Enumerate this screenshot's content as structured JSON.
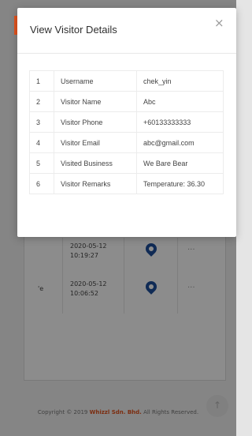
{
  "modal": {
    "title": "View Visitor Details",
    "close": "×",
    "rows": [
      {
        "num": "1",
        "label": "Username",
        "value": "chek_yin"
      },
      {
        "num": "2",
        "label": "Visitor Name",
        "value": "Abc"
      },
      {
        "num": "3",
        "label": "Visitor Phone",
        "value": "+60133333333"
      },
      {
        "num": "4",
        "label": "Visitor Email",
        "value": "abc@gmail.com"
      },
      {
        "num": "5",
        "label": "Visited Business",
        "value": "We Bare Bear"
      },
      {
        "num": "6",
        "label": "Visitor Remarks",
        "value": "Temperature: 36.30"
      }
    ]
  },
  "background_table": {
    "rows": [
      {
        "lead": "",
        "date": "2020-05-12",
        "time": "10:19:27",
        "pin_icon": "location-pin-icon",
        "more": "···"
      },
      {
        "lead": "'e",
        "date": "2020-05-12",
        "time": "10:06:52",
        "pin_icon": "location-pin-icon",
        "more": "···"
      }
    ]
  },
  "footer": {
    "prefix": "Copyright © 2019",
    "brand": "Whizzl Sdn. Bhd.",
    "suffix": "All Rights Reserved."
  },
  "scroll_top": {
    "icon": "arrow-up-icon",
    "glyph": "↑"
  },
  "colors": {
    "accent": "#e2531e",
    "pin": "#1e4f9c"
  }
}
